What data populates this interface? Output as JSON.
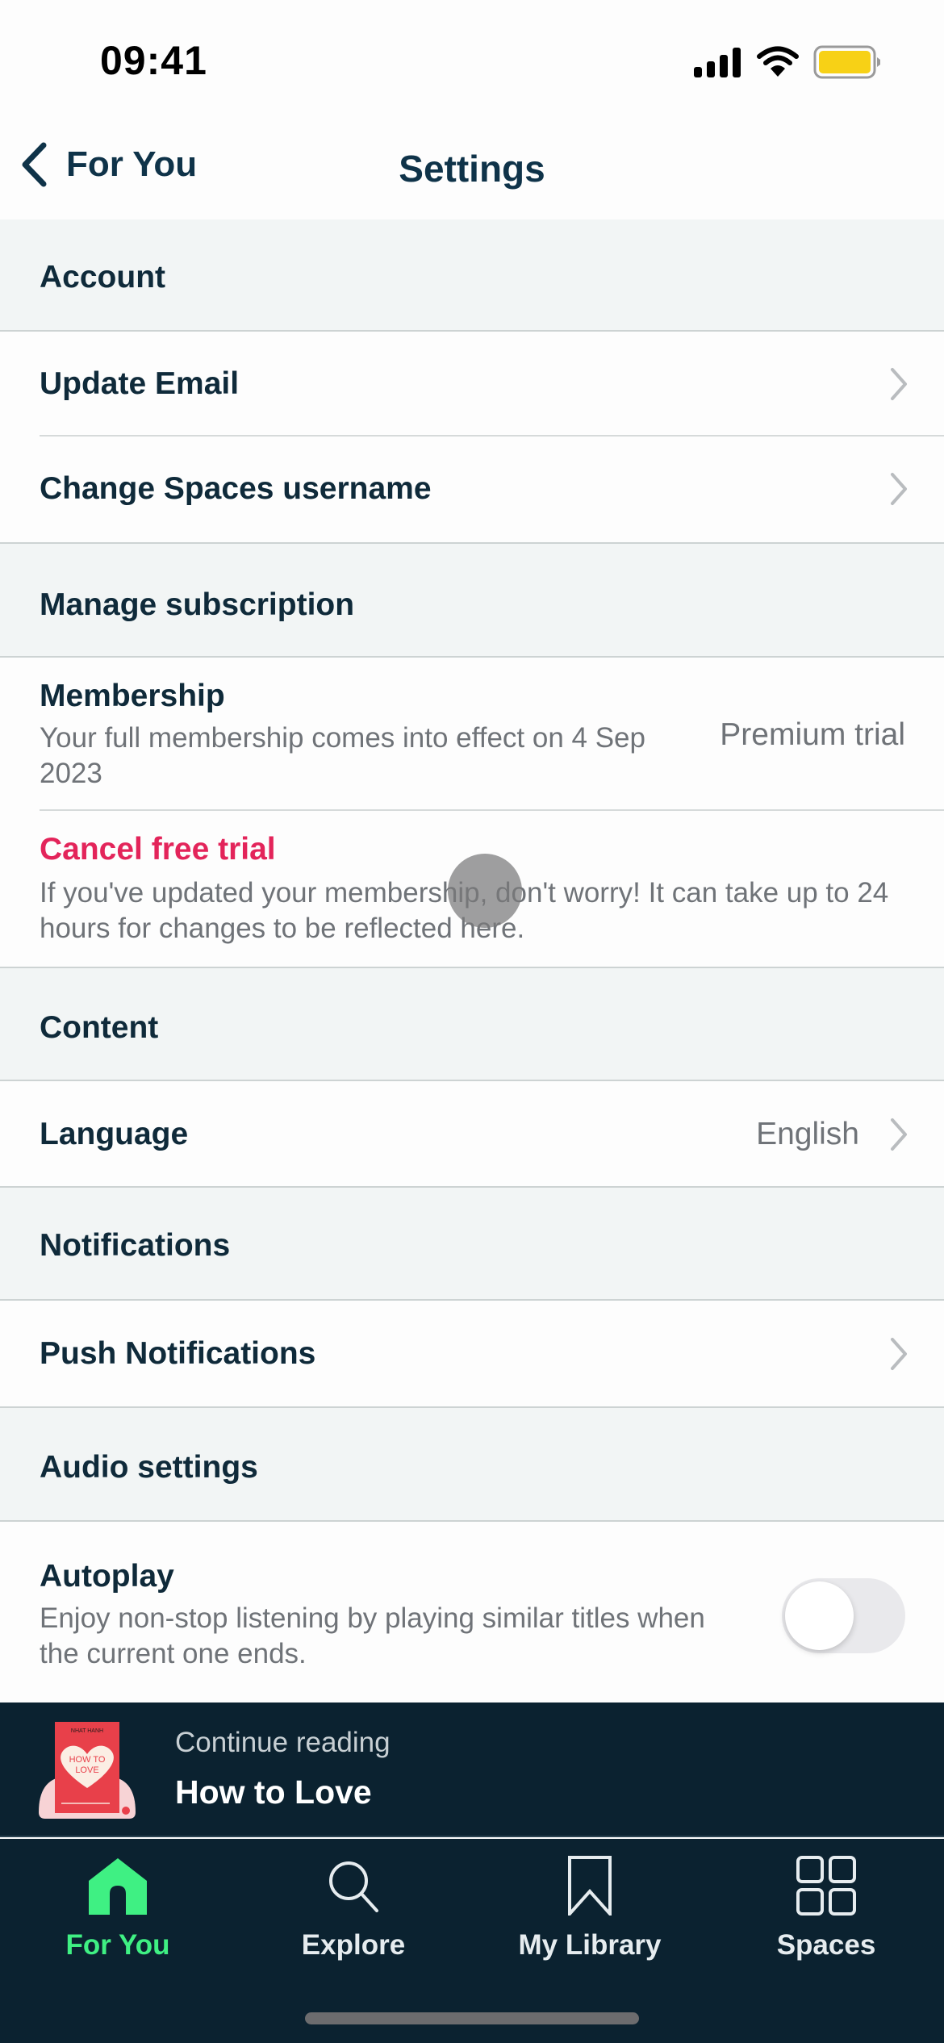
{
  "status_bar": {
    "time": "09:41",
    "icons": [
      "cellular-signal-icon",
      "wifi-icon",
      "battery-icon"
    ],
    "battery_color": "#f7d116"
  },
  "nav": {
    "back_label": "For You",
    "back_icon": "chevron-left-icon",
    "title": "Settings"
  },
  "sections": {
    "account": {
      "header": "Account",
      "items": [
        {
          "label": "Update Email",
          "icon": "chevron-right-icon"
        },
        {
          "label": "Change Spaces username",
          "icon": "chevron-right-icon"
        }
      ]
    },
    "subscription": {
      "header": "Manage subscription",
      "membership": {
        "title": "Membership",
        "subtitle": "Your full membership comes into effect on 4 Sep 2023",
        "value": "Premium trial"
      },
      "cancel": {
        "title": "Cancel free trial",
        "subtitle": "If you've updated your membership, don't worry! It can take up to 24 hours for changes to be reflected here.",
        "color": "#e3245a"
      }
    },
    "content": {
      "header": "Content",
      "language": {
        "label": "Language",
        "value": "English",
        "icon": "chevron-right-icon"
      }
    },
    "notifications": {
      "header": "Notifications",
      "push": {
        "label": "Push Notifications",
        "icon": "chevron-right-icon"
      }
    },
    "audio": {
      "header": "Audio settings",
      "autoplay": {
        "title": "Autoplay",
        "subtitle": "Enjoy non-stop listening by playing similar titles when the current one ends.",
        "enabled": false
      }
    }
  },
  "mini_player": {
    "label": "Continue reading",
    "title": "How to Love",
    "cover": {
      "title_line1": "HOW TO",
      "title_line2": "LOVE",
      "author": "NHAT HANH",
      "color": "#e8404a"
    }
  },
  "tab_bar": {
    "active_color": "#3ff083",
    "tabs": [
      {
        "label": "For You",
        "icon": "home-icon",
        "active": true
      },
      {
        "label": "Explore",
        "icon": "search-icon",
        "active": false
      },
      {
        "label": "My Library",
        "icon": "bookmark-icon",
        "active": false
      },
      {
        "label": "Spaces",
        "icon": "grid-icon",
        "active": false
      }
    ]
  }
}
